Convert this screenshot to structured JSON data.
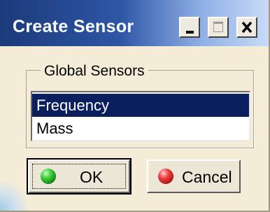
{
  "window": {
    "title": "Create Sensor",
    "controls": {
      "minimize": "minimize-icon",
      "maximize": "maximize-icon",
      "close": "close-icon"
    }
  },
  "group": {
    "label": "Global Sensors",
    "items": [
      {
        "label": "Frequency",
        "selected": true
      },
      {
        "label": "Mass",
        "selected": false
      }
    ]
  },
  "buttons": {
    "ok": {
      "label": "OK",
      "icon": "green-ball-icon"
    },
    "cancel": {
      "label": "Cancel",
      "icon": "red-ball-icon"
    }
  },
  "colors": {
    "title_bar_start": "#1b3a7a",
    "title_bar_end": "#c9dbf7",
    "dialog_background": "#f5ecd7",
    "selection": "#0b1f5e"
  }
}
